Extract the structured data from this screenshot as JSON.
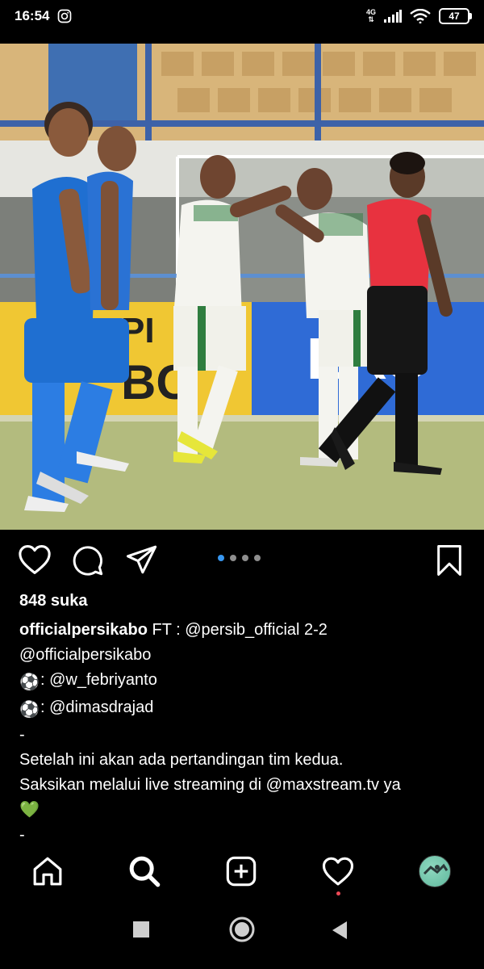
{
  "status_bar": {
    "time": "16:54",
    "network": "4G",
    "battery": "47",
    "icons": [
      "instagram-icon",
      "signal-icon",
      "wifi-icon",
      "battery-icon"
    ]
  },
  "post": {
    "image_alt": "Football match photo",
    "actions": [
      "like-heart-icon",
      "comment-icon",
      "share-send-icon",
      "bookmark-icon"
    ],
    "carousel": {
      "total": 4,
      "active": 1
    },
    "likes": "848 suka",
    "caption": {
      "username": "officialpersikabo",
      "line1_text": " FT : @persib_official 2-2",
      "line2": "@officialpersikabo",
      "scorer1": ": @w_febriyanto",
      "scorer2": ": @dimasdrajad",
      "dash1": "-",
      "line5": "Setelah ini akan ada pertandingan tim kedua.",
      "line6": "Saksikan melalui live streaming di @maxstream.tv ya",
      "heart_emoji": "💚",
      "dash2": "-"
    }
  },
  "bottom_nav": {
    "items": [
      "home-icon",
      "search-icon",
      "add-post-icon",
      "activity-heart-icon",
      "profile-avatar"
    ]
  },
  "colors": {
    "background": "#000000",
    "text": "#ffffff",
    "active_dot": "#3897f0",
    "notification": "#ed4956",
    "persib_blue": "#1f6fd1",
    "referee_red": "#e8323f"
  }
}
